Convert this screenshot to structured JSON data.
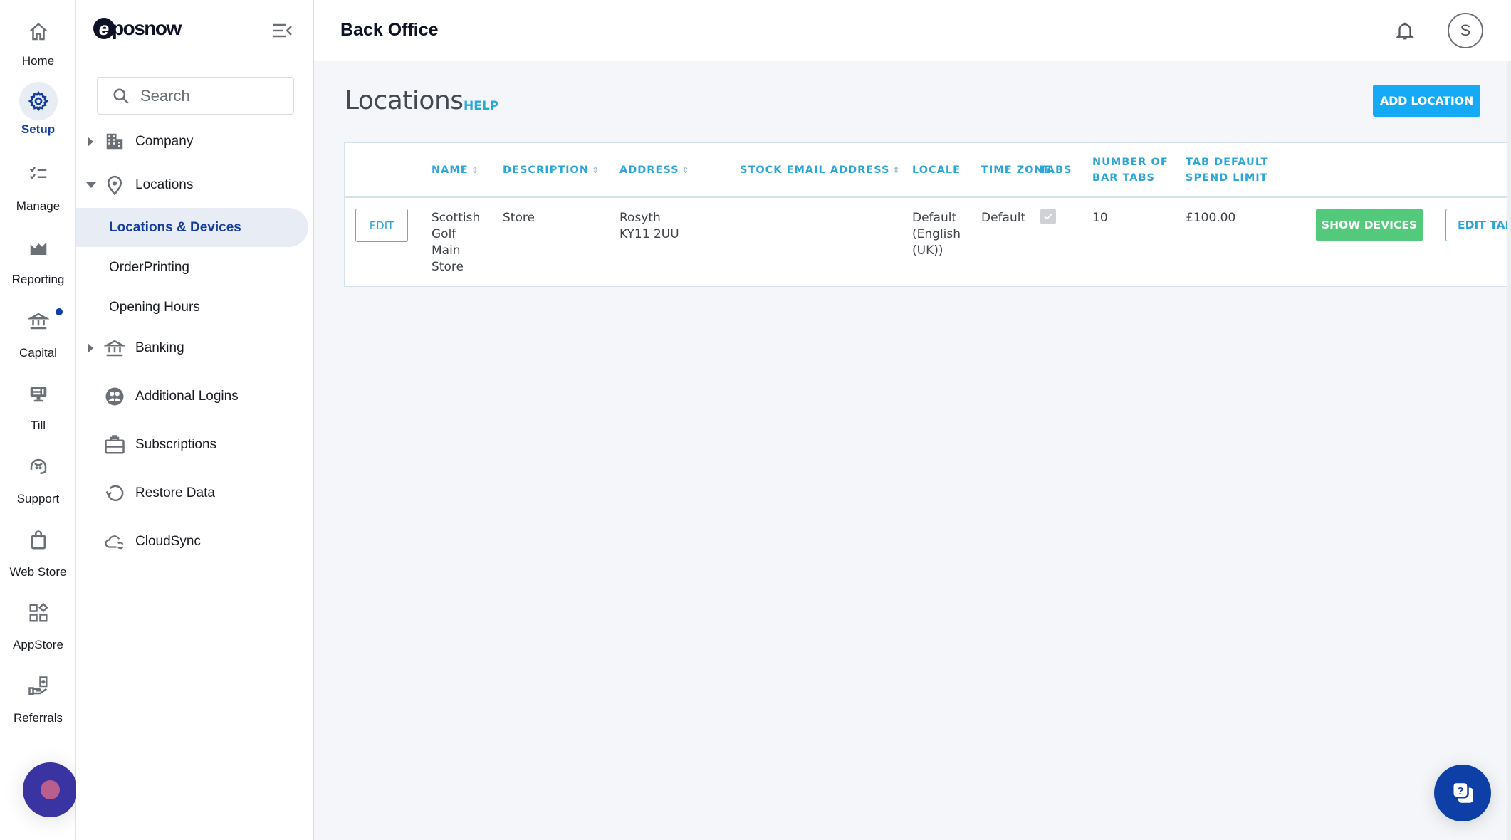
{
  "rail": {
    "items": [
      {
        "label": "Home",
        "icon": "home-icon"
      },
      {
        "label": "Setup",
        "icon": "gear-icon",
        "active": true
      },
      {
        "label": "Manage",
        "icon": "checklist-icon"
      },
      {
        "label": "Reporting",
        "icon": "chart-icon"
      },
      {
        "label": "Capital",
        "icon": "bank-icon",
        "notification": true
      },
      {
        "label": "Till",
        "icon": "till-icon"
      },
      {
        "label": "Support",
        "icon": "headset-icon"
      },
      {
        "label": "Web Store",
        "icon": "shopping-bag-icon"
      },
      {
        "label": "AppStore",
        "icon": "apps-icon"
      },
      {
        "label": "Referrals",
        "icon": "referral-hand-icon"
      }
    ]
  },
  "sidebar": {
    "brand": {
      "mark": "e",
      "text": "posnow"
    },
    "search": {
      "placeholder": "Search",
      "value": ""
    },
    "items": [
      {
        "label": "Company",
        "icon": "building-icon",
        "expandable": true,
        "expanded": false
      },
      {
        "label": "Locations",
        "icon": "map-pin-icon",
        "expandable": true,
        "expanded": true
      },
      {
        "label": "Banking",
        "icon": "bank-icon",
        "expandable": true,
        "expanded": false
      },
      {
        "label": "Additional Logins",
        "icon": "users-circle-icon"
      },
      {
        "label": "Subscriptions",
        "icon": "briefcase-icon"
      },
      {
        "label": "Restore Data",
        "icon": "restore-icon"
      },
      {
        "label": "CloudSync",
        "icon": "cloud-sync-icon"
      }
    ],
    "locations_children": [
      {
        "label": "Locations & Devices",
        "active": true
      },
      {
        "label": "OrderPrinting"
      },
      {
        "label": "Opening Hours"
      }
    ]
  },
  "header": {
    "title": "Back Office",
    "avatar_initial": "S"
  },
  "page": {
    "title": "Locations",
    "help_label": "HELP",
    "add_button_label": "ADD LOCATION"
  },
  "table": {
    "columns": [
      {
        "label": "NAME",
        "sortable": true
      },
      {
        "label": "DESCRIPTION",
        "sortable": true
      },
      {
        "label": "ADDRESS",
        "sortable": true
      },
      {
        "label": "STOCK EMAIL ADDRESS",
        "sortable": true
      },
      {
        "label": "LOCALE",
        "sortable": false
      },
      {
        "label": "TIME ZONE",
        "sortable": false
      },
      {
        "label": "TABS",
        "sortable": false
      },
      {
        "label": "NUMBER OF BAR TABS",
        "line1": "NUMBER OF",
        "line2": "BAR TABS",
        "sortable": false
      },
      {
        "label": "TAB DEFAULT SPEND LIMIT",
        "line1": "TAB DEFAULT",
        "line2": "SPEND LIMIT",
        "sortable": false
      }
    ],
    "sort_glyph": "⇕",
    "rows": [
      {
        "edit_label": "EDIT",
        "name": "Scottish Golf Main Store",
        "description": "Store",
        "address_line1": "Rosyth",
        "address_line2": "KY11 2UU",
        "stock_email": "",
        "locale": "Default (English (UK))",
        "time_zone": "Default",
        "tabs_enabled": true,
        "bar_tabs": "10",
        "spend_limit": "£100.00",
        "show_devices_label": "SHOW DEVICES",
        "edit_table_plan_label": "EDIT TABLE PLA"
      }
    ]
  },
  "colors": {
    "accent_blue": "#14aaf5",
    "header_text_blue": "#2ca5d8",
    "active_nav": "#163d9e",
    "success_green": "#52c97b",
    "help_fab": "#0d3fa6"
  }
}
